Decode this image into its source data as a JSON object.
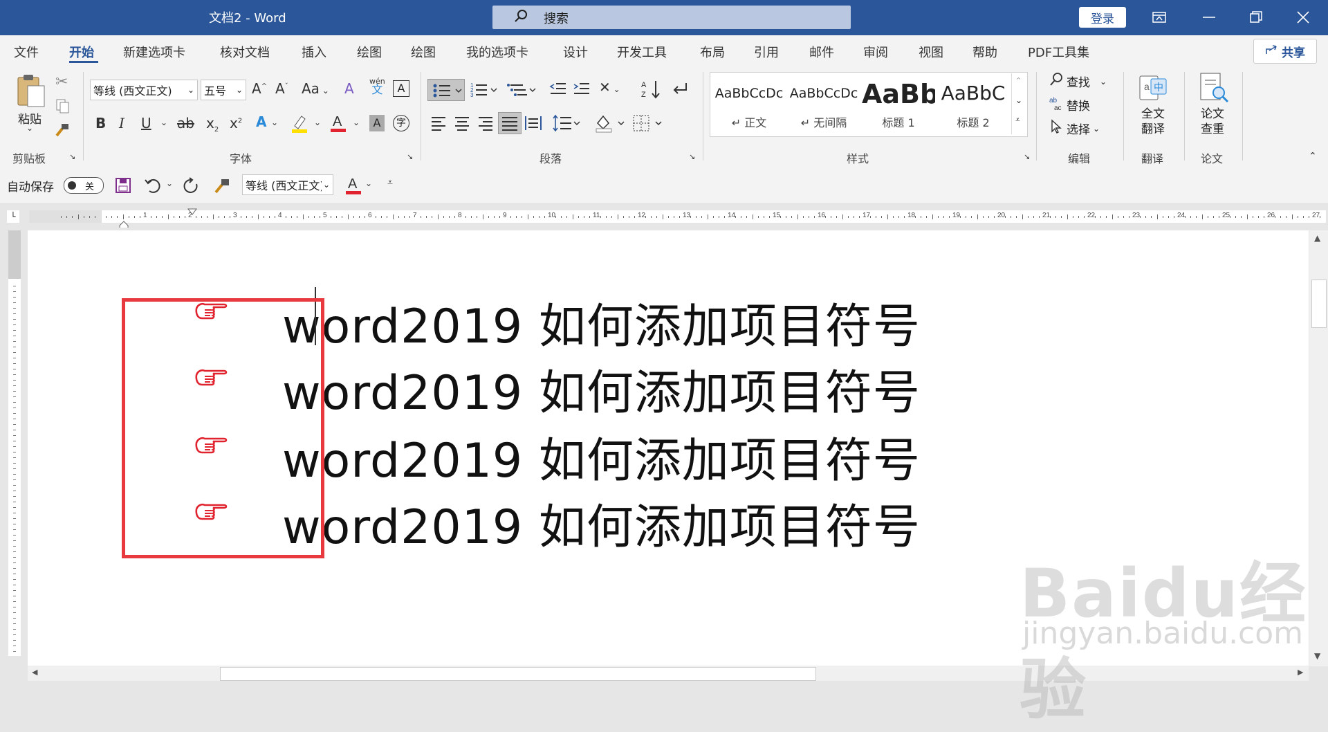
{
  "window": {
    "title": "文档2  -  Word",
    "search_label": "搜索",
    "login_label": "登录",
    "accent": "#2b579a"
  },
  "menu": {
    "tabs": [
      "文件",
      "开始",
      "新建选项卡",
      "核对文档",
      "插入",
      "绘图",
      "绘图",
      "我的选项卡",
      "设计",
      "开发工具",
      "布局",
      "引用",
      "邮件",
      "审阅",
      "视图",
      "帮助",
      "PDF工具集"
    ],
    "active": "开始",
    "share_label": "共享"
  },
  "ribbon": {
    "clipboard": {
      "paste_label": "粘贴",
      "group_label": "剪贴板"
    },
    "font": {
      "font_name": "等线 (西文正文)",
      "font_size": "五号",
      "group_label": "字体",
      "change_case_label": "Aa",
      "wen_label": "wén",
      "wen_char": "文"
    },
    "paragraph": {
      "group_label": "段落"
    },
    "styles": {
      "group_label": "样式",
      "items": [
        {
          "preview": "AaBbCcDc",
          "name": "↵ 正文"
        },
        {
          "preview": "AaBbCcDc",
          "name": "↵ 无间隔"
        },
        {
          "preview": "AaBb",
          "name": "标题 1"
        },
        {
          "preview": "AaBbC",
          "name": "标题 2"
        }
      ]
    },
    "editing": {
      "find_label": "查找",
      "replace_label": "替换",
      "select_label": "选择",
      "group_label": "编辑"
    },
    "translate": {
      "full_label_1": "全文",
      "full_label_2": "翻译",
      "group_label": "翻译"
    },
    "paper": {
      "label_1": "论文",
      "label_2": "查重",
      "group_label": "论文"
    }
  },
  "qat": {
    "autosave_label": "自动保存",
    "toggle_state": "关",
    "font_name": "等线 (西文正文)"
  },
  "document": {
    "lines": [
      "word2019 如何添加项目符号",
      "word2019 如何添加项目符号",
      "word2019 如何添加项目符号",
      "word2019 如何添加项目符号"
    ],
    "bullet_icon": "pointing-hand-icon",
    "bullet_color": "#e0232e",
    "highlight_box_color": "#e8393f"
  },
  "ruler": {
    "ticks": [
      "1",
      "2",
      "3",
      "4",
      "5",
      "6",
      "7",
      "8",
      "9",
      "10",
      "11",
      "12",
      "13",
      "14",
      "15",
      "16",
      "17",
      "18",
      "19",
      "20",
      "21",
      "22",
      "23",
      "24",
      "25",
      "26",
      "27"
    ]
  },
  "watermark": {
    "brand": "Baidu经验",
    "url": "jingyan.baidu.com"
  }
}
